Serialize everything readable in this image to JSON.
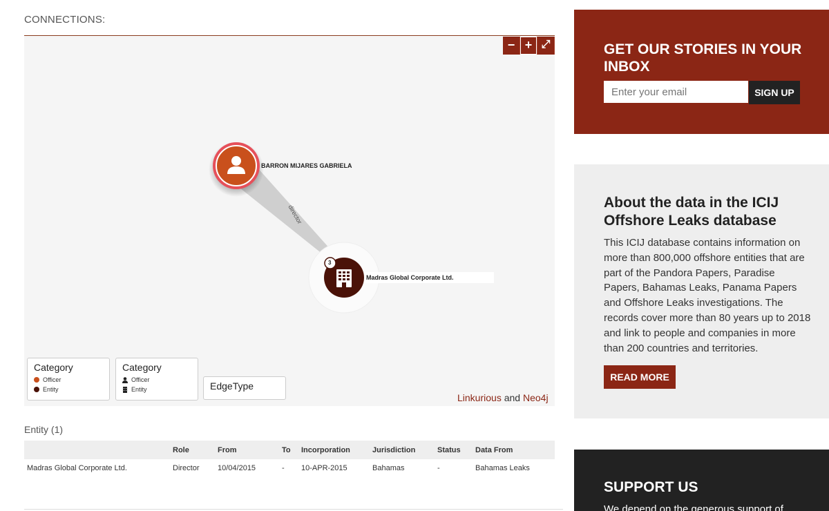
{
  "connections": {
    "label": "CONNECTIONS:"
  },
  "zoom": {
    "minus": "−",
    "plus": "+",
    "fullscreen": "⤢"
  },
  "graph": {
    "officer_node": {
      "name": "BARRON MIJARES GABRIELA"
    },
    "entity_node": {
      "name": "Madras Global Corporate Ltd.",
      "badge": "3"
    },
    "edge_label": "director"
  },
  "legend": {
    "category_color": {
      "title": "Category",
      "items": [
        {
          "label": "Officer",
          "color": "#c9501c"
        },
        {
          "label": "Entity",
          "color": "#4a1208"
        }
      ]
    },
    "category_icon": {
      "title": "Category",
      "items": [
        {
          "label": "Officer"
        },
        {
          "label": "Entity"
        }
      ]
    },
    "edge_type": {
      "title": "EdgeType"
    }
  },
  "credits": {
    "linkurious": "Linkurious",
    "and": "and",
    "neo4j": "Neo4j"
  },
  "entity_section": {
    "heading": "Entity (1)",
    "columns": [
      "",
      "Role",
      "From",
      "To",
      "Incorporation",
      "Jurisdiction",
      "Status",
      "Data From"
    ],
    "rows": [
      [
        "Madras Global Corporate Ltd.",
        "Director",
        "10/04/2015",
        "-",
        "10-APR-2015",
        "Bahamas",
        "-",
        "Bahamas Leaks"
      ]
    ]
  },
  "signup": {
    "title": "GET OUR STORIES IN YOUR INBOX",
    "placeholder": "Enter your email",
    "button": "SIGN UP"
  },
  "about": {
    "title": "About the data in the ICIJ Offshore Leaks database",
    "body": "This ICIJ database contains information on more than 800,000 offshore entities that are part of the Pandora Papers, Paradise Papers, Bahamas Leaks, Panama Papers and Offshore Leaks investigations. The records cover more than 80 years up to 2018 and link to people and companies in more than 200 countries and territories.",
    "button": "READ MORE"
  },
  "support": {
    "title": "SUPPORT US",
    "body": "We depend on the generous support of"
  },
  "colors": {
    "brand": "#8b2615",
    "officer": "#c9501c",
    "entity": "#4a1208",
    "dark": "#222222"
  }
}
